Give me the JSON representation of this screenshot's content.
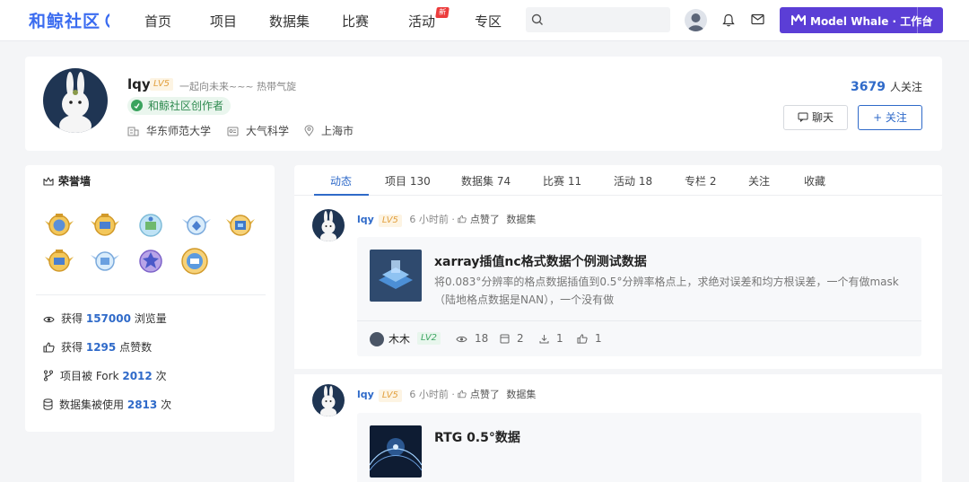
{
  "topbar": {
    "logo_text": "和鲸社区",
    "nav": [
      {
        "label": "首页"
      },
      {
        "label": "项目"
      },
      {
        "label": "数据集"
      },
      {
        "label": "比赛"
      },
      {
        "label": "活动",
        "badge": "新"
      },
      {
        "label": "专区"
      }
    ],
    "search": {
      "placeholder": ""
    },
    "workspace_button": {
      "brand": "Model Whale",
      "label": "工作台"
    }
  },
  "profile": {
    "name": "lqy",
    "level": "LV5",
    "motto": "一起向未来~~~ 热带气旋",
    "creator_badge": "和鲸社区创作者",
    "school": "华东师范大学",
    "major": "大气科学",
    "city": "上海市",
    "followers_count": "3679",
    "followers_label": "人关注",
    "chat_button": "聊天",
    "follow_button": "+ 关注"
  },
  "honor": {
    "title": "荣誉墙",
    "badge_icons": [
      "gold-winged-badge",
      "gold-winged-badge",
      "blue-circle-badge",
      "blue-winged-badge",
      "gold-winged-badge",
      "gold-winged-badge",
      "blue-winged-badge",
      "purple-badge",
      "gold-ring-badge"
    ],
    "stats": [
      {
        "prefix": "获得",
        "value": "157000",
        "suffix": "浏览量",
        "icon": "eye-icon"
      },
      {
        "prefix": "获得",
        "value": "1295",
        "suffix": "点赞数",
        "icon": "thumbs-up-icon"
      },
      {
        "prefix": "项目被 Fork",
        "value": "2012",
        "suffix": "次",
        "icon": "fork-icon"
      },
      {
        "prefix": "数据集被使用",
        "value": "2813",
        "suffix": "次",
        "icon": "database-icon"
      }
    ]
  },
  "tabs": [
    {
      "label": "动态",
      "active": true
    },
    {
      "label": "项目 130"
    },
    {
      "label": "数据集 74"
    },
    {
      "label": "比赛 11"
    },
    {
      "label": "活动 18"
    },
    {
      "label": "专栏 2"
    },
    {
      "label": "关注"
    },
    {
      "label": "收藏"
    }
  ],
  "posts": [
    {
      "user": "lqy",
      "level": "LV5",
      "time": "6 小时前",
      "action": "点赞了",
      "type": "数据集",
      "card": {
        "title": "xarray插值nc格式数据个例测试数据",
        "desc": "将0.083°分辨率的格点数据插值到0.5°分辨率格点上，求绝对误差和均方根误差，一个有做mask（陆地格点数据是NAN），一个没有做",
        "author": "木木",
        "author_level": "LV2",
        "views": "18",
        "copies": "2",
        "downloads": "1",
        "likes": "1"
      }
    },
    {
      "user": "lqy",
      "level": "LV5",
      "time": "6 小时前",
      "action": "点赞了",
      "type": "数据集",
      "card": {
        "title": "RTG 0.5°数据"
      }
    }
  ],
  "colors": {
    "accent": "#2f6ac9",
    "brand_purple": "#5b3ed6",
    "level_gold": "#e2a03f",
    "creator_green": "#3aa35e"
  }
}
